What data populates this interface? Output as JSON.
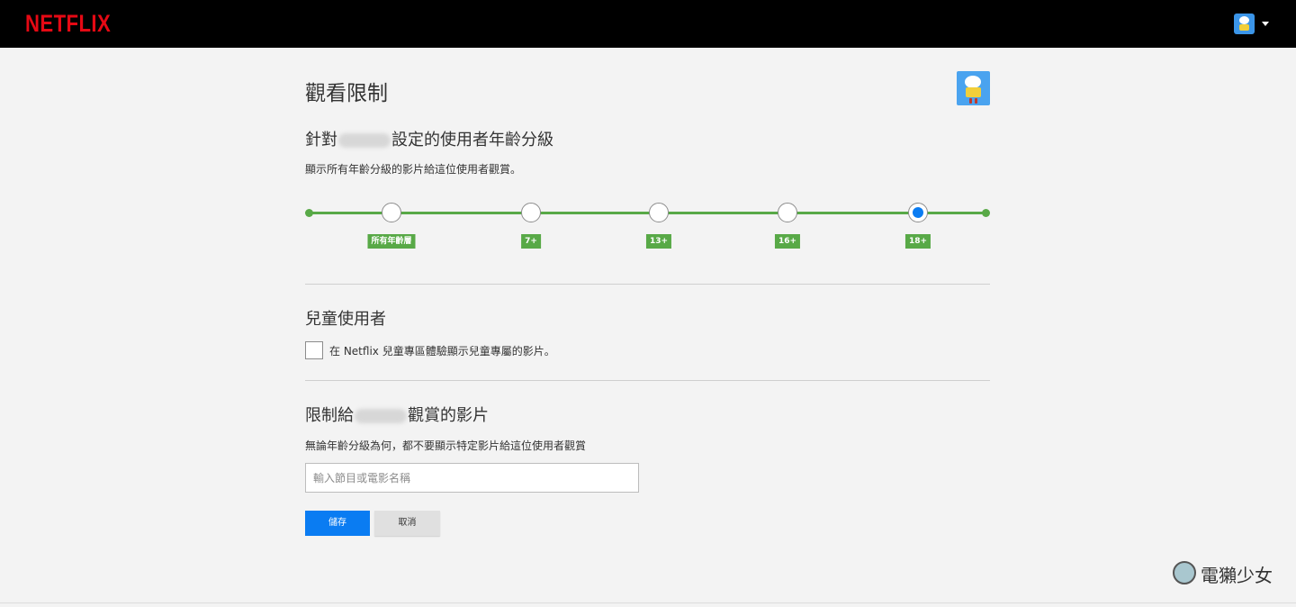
{
  "header": {
    "logo_text": "NETFLIX",
    "avatar_icon": "profile-avatar-icon",
    "caret_icon": "caret-down-icon"
  },
  "page": {
    "title": "觀看限制",
    "avatar_icon": "profile-avatar-icon"
  },
  "rating_section": {
    "title_prefix": "針對",
    "title_suffix": "設定的使用者年齡分級",
    "description": "顯示所有年齡分級的影片給這位使用者觀賞。",
    "levels": [
      "所有年齡層",
      "7+",
      "13+",
      "16+",
      "18+"
    ],
    "selected": "18+",
    "accent_color": "#58a947",
    "selected_color": "#0a7cf2"
  },
  "kids_section": {
    "title": "兒童使用者",
    "checkbox_label": "在 Netflix 兒童專區體驗顯示兒童專屬的影片。",
    "checked": false
  },
  "restrict_section": {
    "title_prefix": "限制給",
    "title_suffix": "觀賞的影片",
    "description": "無論年齡分級為何，都不要顯示特定影片給這位使用者觀賞",
    "search_placeholder": "輸入節目或電影名稱"
  },
  "actions": {
    "save_label": "儲存",
    "cancel_label": "取消"
  },
  "watermark": {
    "text": "電獺少女"
  }
}
